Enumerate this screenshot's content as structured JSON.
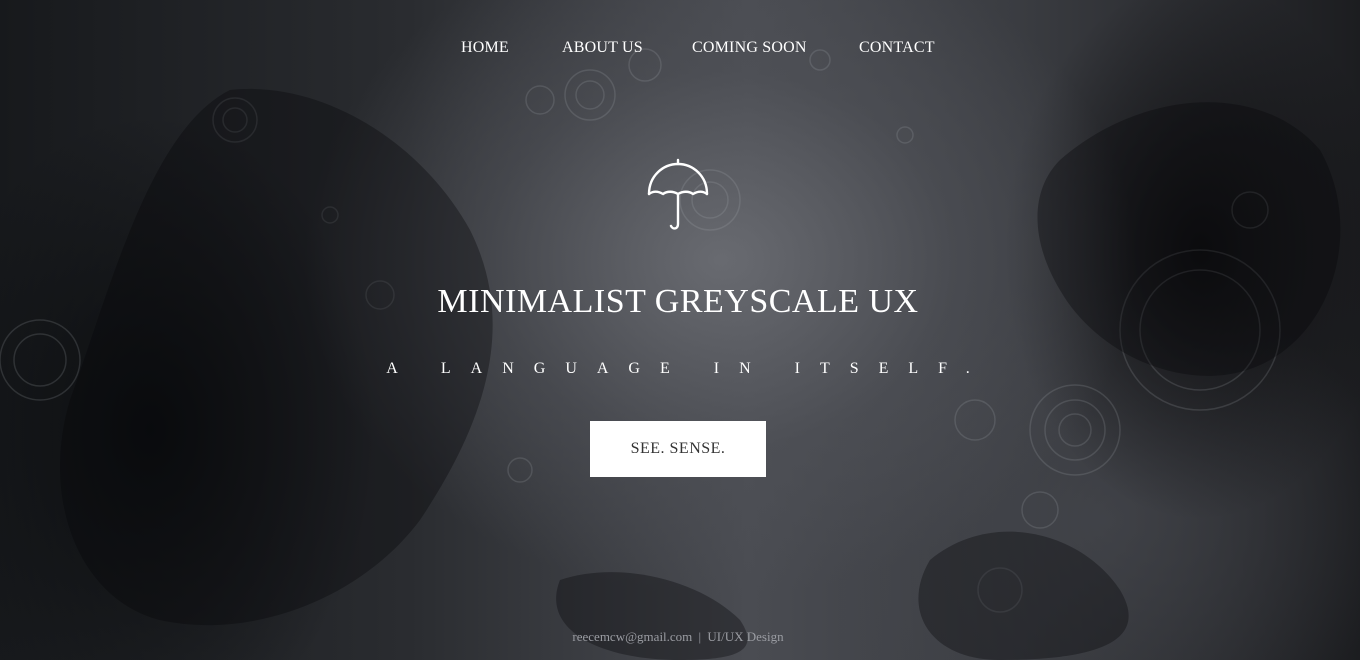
{
  "nav": {
    "items": [
      {
        "label": "HOME"
      },
      {
        "label": "ABOUT US"
      },
      {
        "label": "COMING SOON"
      },
      {
        "label": "CONTACT"
      }
    ]
  },
  "hero": {
    "icon": "umbrella-icon",
    "title": "MINIMALIST GREYSCALE UX",
    "tagline": "A LANGUAGE IN ITSELF.",
    "cta_label": "SEE. SENSE."
  },
  "footer": {
    "email": "reecemcw@gmail.com",
    "separator": "|",
    "role": "UI/UX Design"
  },
  "colors": {
    "text": "#ffffff",
    "button_bg": "#ffffff",
    "button_text": "#333333",
    "footer_text": "#9a9ca2"
  }
}
